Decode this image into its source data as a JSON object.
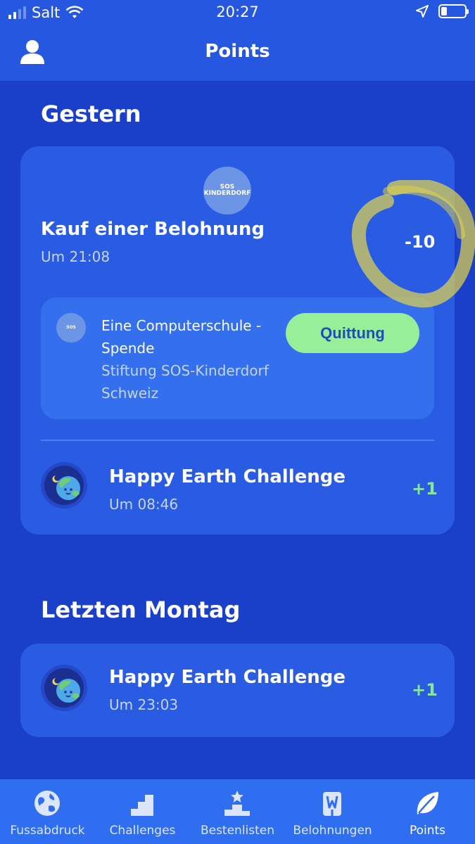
{
  "status_bar": {
    "carrier": "Salt",
    "time": "20:27"
  },
  "header": {
    "title": "Points",
    "profile_icon": "person-icon"
  },
  "sections": [
    {
      "title": "Gestern",
      "entries": [
        {
          "title": "Kauf einer Belohnung",
          "subtitle": "Um 21:08",
          "points": "-10",
          "logo_text_line1": "SOS",
          "logo_text_line2": "KINDERDORF",
          "reward": {
            "name_line1": "Eine Computerschule -",
            "name_line2": "Spende",
            "org_line1": "Stiftung SOS-Kinderdorf",
            "org_line2": "Schweiz",
            "button_label": "Quittung"
          }
        },
        {
          "title": "Happy Earth Challenge",
          "subtitle": "Um 08:46",
          "points": "+1"
        }
      ]
    },
    {
      "title": "Letzten Montag",
      "entries": [
        {
          "title": "Happy Earth Challenge",
          "subtitle": "Um 23:03",
          "points": "+1"
        }
      ]
    }
  ],
  "tab_bar": {
    "tabs": [
      {
        "label": "Fussabdruck",
        "icon": "globe-icon"
      },
      {
        "label": "Challenges",
        "icon": "stairs-icon"
      },
      {
        "label": "Bestenlisten",
        "icon": "podium-icon"
      },
      {
        "label": "Belohnungen",
        "icon": "gift-icon"
      },
      {
        "label": "Points",
        "icon": "leaf-icon"
      }
    ],
    "active": "Points"
  },
  "colors": {
    "background": "#1a3fc9",
    "header": "#2557e0",
    "card": "#2a5ce3",
    "inner_card": "#3470ee",
    "button": "#98ef99",
    "positive_points": "#86e6a0",
    "highlight": "#e3d54a"
  }
}
